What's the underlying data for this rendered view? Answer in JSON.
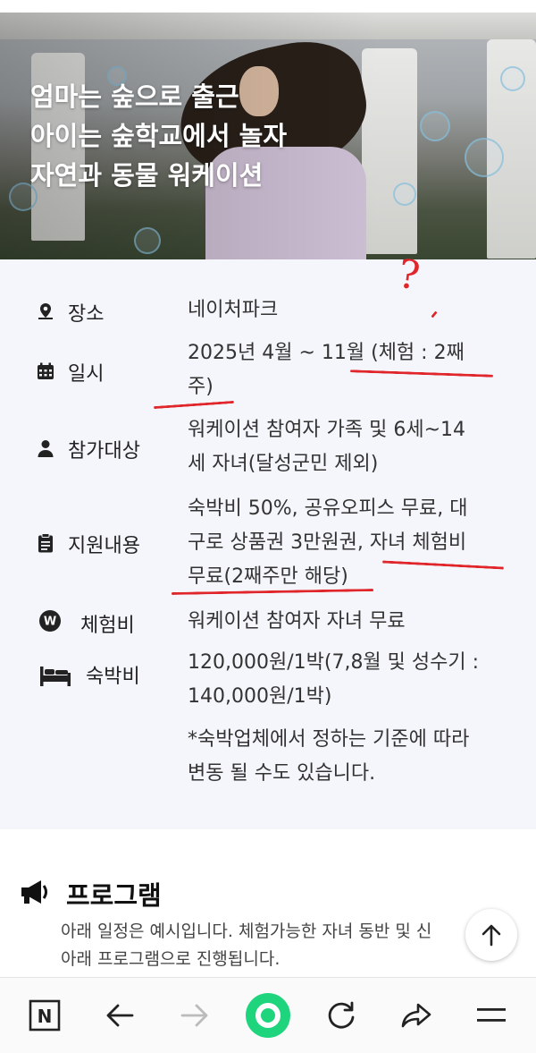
{
  "hero": {
    "title_lines": [
      "엄마는 숲으로 출근",
      "아이는 숲학교에서 놀자",
      "자연과 동물 워케이션"
    ]
  },
  "info": {
    "rows": [
      {
        "icon": "location-icon",
        "label": "장소",
        "value_lines": [
          "네이처파크"
        ]
      },
      {
        "icon": "calendar-icon",
        "label": "일시",
        "value_lines": [
          "2025년 4월 ~ 11월 (체험 : 2째",
          "주)"
        ]
      },
      {
        "icon": "person-icon",
        "label": "참가대상",
        "value_lines": [
          "워케이션 참여자 가족 및 6세~14",
          "세 자녀(달성군민 제외)"
        ]
      },
      {
        "icon": "clipboard-icon",
        "label": "지원내용",
        "value_lines": [
          "숙박비 50%, 공유오피스 무료, 대",
          "구로 상품권 3만원권, 자녀 체험비",
          "무료(2째주만 해당)"
        ]
      },
      {
        "icon": "won-icon",
        "label": "체험비",
        "value_lines": [
          "워케이션 참여자 자녀 무료"
        ]
      },
      {
        "icon": "bed-icon",
        "label": "숙박비",
        "value_lines": [
          "120,000원/1박(7,8월 및 성수기 :",
          "140,000원/1박)"
        ]
      }
    ],
    "note_lines": [
      "*숙박업체에서 정하는 기준에 따라",
      "변동 될 수도 있습니다."
    ],
    "annotation": "?"
  },
  "program": {
    "title": "프로그램",
    "desc_lines": [
      "아래 일정은 예시입니다. 체험가능한 자녀 동반 및 신",
      "아래 프로그램으로 진행됩니다."
    ]
  },
  "colors": {
    "annotation_red": "#e0262b",
    "green_home": "#1ed47d"
  }
}
